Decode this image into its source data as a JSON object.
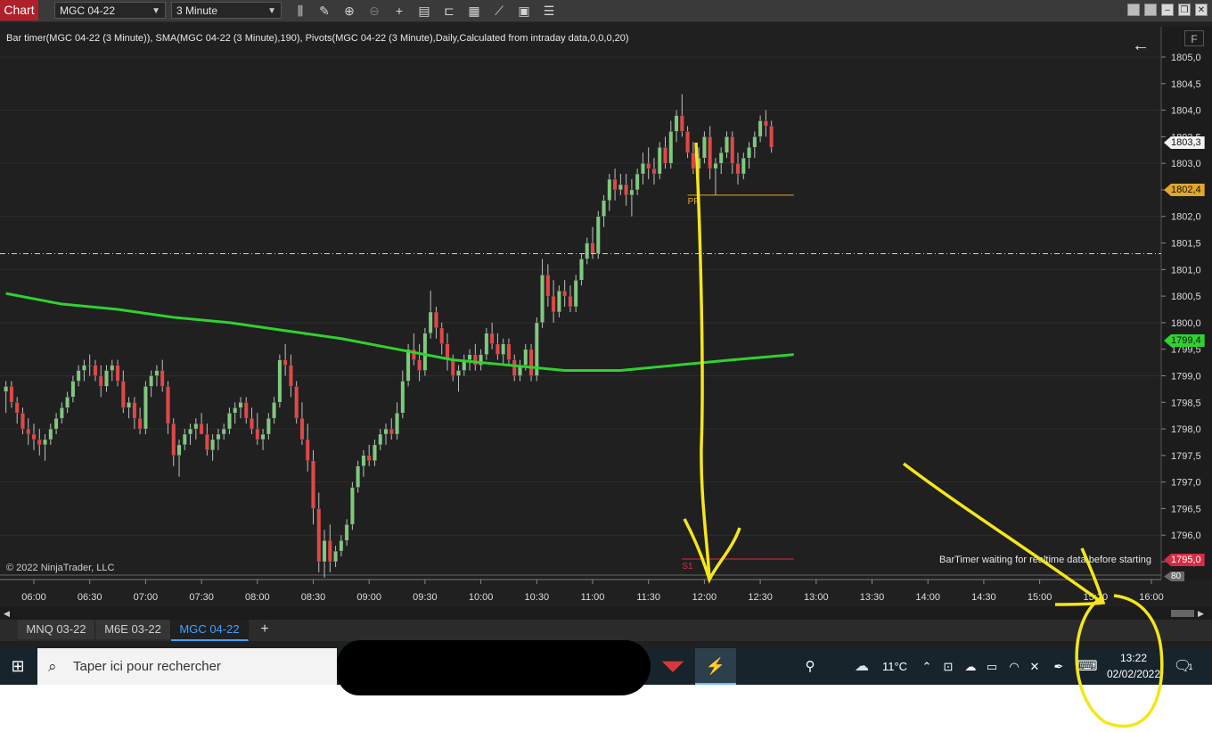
{
  "toolbar": {
    "app_tab": "Chart",
    "instrument": "MGC 04-22",
    "interval": "3 Minute",
    "icons": [
      "bar-type-icon",
      "pencil-icon",
      "zoom-in-icon",
      "zoom-out-icon",
      "crosshair-icon",
      "data-box-icon",
      "properties-icon",
      "strategy-icon",
      "indicator-icon",
      "templates-icon",
      "list-icon"
    ],
    "window_buttons": [
      "restore-icon",
      "restore-icon",
      "minimize-icon",
      "maximize-icon",
      "close-icon"
    ]
  },
  "chart": {
    "indicator_label": "Bar timer(MGC 04-22 (3 Minute)), SMA(MGC 04-22 (3 Minute),190), Pivots(MGC 04-22 (3 Minute),Daily,Calculated from intraday data,0,0,0,20)",
    "copyright": "© 2022 NinjaTrader, LLC",
    "bartimer_message": "BarTimer waiting for realtime data before starting",
    "f_button": "F",
    "pivot_pp_label": "PP",
    "pivot_s1_label": "S1",
    "price_tags": {
      "last": "1803,3",
      "pp": "1802,4",
      "sma": "1799,4",
      "s1": "1795,0",
      "volume": "80"
    }
  },
  "chart_data": {
    "type": "candlestick",
    "instrument": "MGC 04-22",
    "interval": "3 Minute",
    "y_axis_labels": [
      "1805,0",
      "1804,5",
      "1804,0",
      "1803,5",
      "1803,0",
      "1802,5",
      "1802,0",
      "1801,5",
      "1801,0",
      "1800,5",
      "1800,0",
      "1799,5",
      "1799,0",
      "1798,5",
      "1798,0",
      "1797,5",
      "1797,0",
      "1796,5",
      "1796,0",
      "1795,5"
    ],
    "x_axis_labels": [
      "06:00",
      "06:30",
      "07:00",
      "07:30",
      "08:00",
      "08:30",
      "09:00",
      "09:30",
      "10:00",
      "10:30",
      "11:00",
      "11:30",
      "12:00",
      "12:30",
      "13:00",
      "13:30",
      "14:00",
      "14:30",
      "15:00",
      "15:30",
      "16:00"
    ],
    "ylim": [
      1795.2,
      1805.3
    ],
    "start_time": "05:45",
    "bar_minutes": 3,
    "ohlc": [
      [
        1798.7,
        1798.9,
        1798.3,
        1798.8
      ],
      [
        1798.8,
        1798.9,
        1798.4,
        1798.5
      ],
      [
        1798.5,
        1798.6,
        1798.1,
        1798.3
      ],
      [
        1798.3,
        1798.4,
        1797.9,
        1798.0
      ],
      [
        1798.0,
        1798.2,
        1797.7,
        1797.9
      ],
      [
        1797.9,
        1798.1,
        1797.6,
        1797.8
      ],
      [
        1797.8,
        1798.0,
        1797.5,
        1797.7
      ],
      [
        1797.7,
        1797.9,
        1797.4,
        1797.8
      ],
      [
        1797.8,
        1798.1,
        1797.7,
        1798.0
      ],
      [
        1798.0,
        1798.3,
        1797.9,
        1798.2
      ],
      [
        1798.2,
        1798.5,
        1798.1,
        1798.4
      ],
      [
        1798.4,
        1798.7,
        1798.3,
        1798.6
      ],
      [
        1798.6,
        1799.0,
        1798.5,
        1798.9
      ],
      [
        1798.9,
        1799.2,
        1798.8,
        1799.1
      ],
      [
        1799.1,
        1799.3,
        1798.9,
        1799.2
      ],
      [
        1799.2,
        1799.4,
        1799.0,
        1799.2
      ],
      [
        1799.2,
        1799.3,
        1798.9,
        1799.0
      ],
      [
        1799.0,
        1799.2,
        1798.6,
        1798.8
      ],
      [
        1798.8,
        1799.2,
        1798.7,
        1799.1
      ],
      [
        1799.1,
        1799.3,
        1798.9,
        1799.2
      ],
      [
        1799.2,
        1799.3,
        1798.8,
        1798.9
      ],
      [
        1798.9,
        1799.1,
        1798.3,
        1798.4
      ],
      [
        1798.4,
        1798.6,
        1798.2,
        1798.5
      ],
      [
        1798.5,
        1798.6,
        1798.0,
        1798.2
      ],
      [
        1798.2,
        1798.4,
        1797.9,
        1798.0
      ],
      [
        1798.0,
        1798.9,
        1797.9,
        1798.8
      ],
      [
        1798.8,
        1799.1,
        1798.6,
        1799.0
      ],
      [
        1799.0,
        1799.2,
        1798.8,
        1799.1
      ],
      [
        1799.1,
        1799.3,
        1798.7,
        1798.8
      ],
      [
        1798.8,
        1798.9,
        1797.9,
        1798.1
      ],
      [
        1798.1,
        1798.2,
        1797.3,
        1797.5
      ],
      [
        1797.5,
        1797.8,
        1797.1,
        1797.7
      ],
      [
        1797.7,
        1798.0,
        1797.6,
        1797.9
      ],
      [
        1797.9,
        1798.1,
        1797.7,
        1798.0
      ],
      [
        1798.0,
        1798.2,
        1797.8,
        1798.1
      ],
      [
        1798.1,
        1798.3,
        1797.9,
        1797.9
      ],
      [
        1797.9,
        1798.1,
        1797.5,
        1797.6
      ],
      [
        1797.6,
        1797.9,
        1797.4,
        1797.8
      ],
      [
        1797.8,
        1798.0,
        1797.6,
        1797.9
      ],
      [
        1797.9,
        1798.1,
        1797.8,
        1798.0
      ],
      [
        1798.0,
        1798.4,
        1797.9,
        1798.3
      ],
      [
        1798.3,
        1798.5,
        1798.1,
        1798.4
      ],
      [
        1798.4,
        1798.6,
        1798.2,
        1798.5
      ],
      [
        1798.5,
        1798.6,
        1798.1,
        1798.2
      ],
      [
        1798.2,
        1798.4,
        1797.9,
        1798.0
      ],
      [
        1798.0,
        1798.3,
        1797.7,
        1797.8
      ],
      [
        1797.8,
        1798.0,
        1797.6,
        1797.9
      ],
      [
        1797.9,
        1798.3,
        1797.8,
        1798.2
      ],
      [
        1798.2,
        1798.6,
        1798.1,
        1798.5
      ],
      [
        1798.5,
        1799.4,
        1798.4,
        1799.3
      ],
      [
        1799.3,
        1799.6,
        1799.0,
        1799.2
      ],
      [
        1799.2,
        1799.4,
        1798.6,
        1798.8
      ],
      [
        1798.8,
        1798.9,
        1798.1,
        1798.2
      ],
      [
        1798.2,
        1798.5,
        1797.7,
        1797.8
      ],
      [
        1797.8,
        1798.1,
        1797.2,
        1797.4
      ],
      [
        1797.4,
        1797.6,
        1796.2,
        1796.5
      ],
      [
        1796.5,
        1796.8,
        1795.3,
        1795.5
      ],
      [
        1795.5,
        1796.1,
        1795.2,
        1795.9
      ],
      [
        1795.9,
        1796.2,
        1795.3,
        1795.5
      ],
      [
        1795.5,
        1795.8,
        1795.4,
        1795.7
      ],
      [
        1795.7,
        1796.0,
        1795.6,
        1795.9
      ],
      [
        1795.9,
        1796.3,
        1795.8,
        1796.2
      ],
      [
        1796.2,
        1797.0,
        1796.1,
        1796.9
      ],
      [
        1796.9,
        1797.4,
        1796.8,
        1797.3
      ],
      [
        1797.3,
        1797.6,
        1797.1,
        1797.5
      ],
      [
        1797.5,
        1797.7,
        1797.3,
        1797.4
      ],
      [
        1797.4,
        1797.8,
        1797.3,
        1797.7
      ],
      [
        1797.7,
        1798.0,
        1797.6,
        1797.9
      ],
      [
        1797.9,
        1798.1,
        1797.7,
        1798.0
      ],
      [
        1798.0,
        1798.2,
        1797.8,
        1797.9
      ],
      [
        1797.9,
        1798.5,
        1797.8,
        1798.3
      ],
      [
        1798.3,
        1799.1,
        1798.2,
        1798.9
      ],
      [
        1798.9,
        1799.6,
        1798.8,
        1799.5
      ],
      [
        1799.5,
        1799.8,
        1799.2,
        1799.3
      ],
      [
        1799.3,
        1799.6,
        1798.9,
        1799.1
      ],
      [
        1799.1,
        1799.9,
        1799.0,
        1799.8
      ],
      [
        1799.8,
        1800.6,
        1799.7,
        1800.2
      ],
      [
        1800.2,
        1800.3,
        1799.7,
        1799.9
      ],
      [
        1799.9,
        1800.0,
        1799.4,
        1799.6
      ],
      [
        1799.6,
        1799.8,
        1799.1,
        1799.3
      ],
      [
        1799.3,
        1799.4,
        1798.9,
        1799.0
      ],
      [
        1799.0,
        1799.2,
        1798.7,
        1799.1
      ],
      [
        1799.1,
        1799.4,
        1799.0,
        1799.3
      ],
      [
        1799.3,
        1799.5,
        1799.1,
        1799.4
      ],
      [
        1799.4,
        1799.6,
        1799.1,
        1799.2
      ],
      [
        1799.2,
        1799.5,
        1799.1,
        1799.4
      ],
      [
        1799.4,
        1799.9,
        1799.3,
        1799.8
      ],
      [
        1799.8,
        1800.0,
        1799.5,
        1799.6
      ],
      [
        1799.6,
        1799.8,
        1799.3,
        1799.4
      ],
      [
        1799.4,
        1799.7,
        1799.2,
        1799.6
      ],
      [
        1799.6,
        1799.7,
        1799.2,
        1799.3
      ],
      [
        1799.3,
        1799.4,
        1798.9,
        1799.0
      ],
      [
        1799.0,
        1799.3,
        1798.9,
        1799.2
      ],
      [
        1799.2,
        1799.6,
        1799.1,
        1799.5
      ],
      [
        1799.5,
        1799.6,
        1798.9,
        1799.0
      ],
      [
        1799.0,
        1800.1,
        1798.9,
        1800.0
      ],
      [
        1800.0,
        1801.2,
        1799.9,
        1800.9
      ],
      [
        1800.9,
        1801.1,
        1800.3,
        1800.5
      ],
      [
        1800.5,
        1800.8,
        1800.0,
        1800.2
      ],
      [
        1800.2,
        1800.7,
        1800.1,
        1800.6
      ],
      [
        1800.6,
        1800.8,
        1800.3,
        1800.5
      ],
      [
        1800.5,
        1800.7,
        1800.2,
        1800.3
      ],
      [
        1800.3,
        1800.9,
        1800.2,
        1800.8
      ],
      [
        1800.8,
        1801.3,
        1800.7,
        1801.2
      ],
      [
        1801.2,
        1801.6,
        1801.1,
        1801.5
      ],
      [
        1801.5,
        1801.8,
        1801.2,
        1801.3
      ],
      [
        1801.3,
        1802.1,
        1801.2,
        1802.0
      ],
      [
        1802.0,
        1802.4,
        1801.8,
        1802.3
      ],
      [
        1802.3,
        1802.8,
        1802.1,
        1802.7
      ],
      [
        1802.7,
        1802.9,
        1802.3,
        1802.5
      ],
      [
        1802.5,
        1802.8,
        1802.4,
        1802.6
      ],
      [
        1802.6,
        1802.8,
        1802.2,
        1802.4
      ],
      [
        1802.4,
        1802.7,
        1802.0,
        1802.5
      ],
      [
        1802.5,
        1802.9,
        1802.4,
        1802.8
      ],
      [
        1802.8,
        1803.2,
        1802.6,
        1803.0
      ],
      [
        1803.0,
        1803.3,
        1802.7,
        1802.9
      ],
      [
        1802.9,
        1803.1,
        1802.6,
        1802.8
      ],
      [
        1802.8,
        1803.4,
        1802.7,
        1803.3
      ],
      [
        1803.3,
        1803.5,
        1802.9,
        1803.0
      ],
      [
        1803.0,
        1803.8,
        1802.9,
        1803.6
      ],
      [
        1803.6,
        1804.0,
        1803.4,
        1803.9
      ],
      [
        1803.9,
        1804.3,
        1803.5,
        1803.6
      ],
      [
        1803.6,
        1803.7,
        1803.1,
        1803.2
      ],
      [
        1803.2,
        1803.4,
        1802.8,
        1802.9
      ],
      [
        1802.9,
        1803.3,
        1802.7,
        1803.1
      ],
      [
        1803.1,
        1803.6,
        1803.0,
        1803.5
      ],
      [
        1803.5,
        1803.7,
        1802.7,
        1802.9
      ],
      [
        1802.9,
        1803.1,
        1802.4,
        1803.0
      ],
      [
        1803.0,
        1803.3,
        1802.8,
        1803.2
      ],
      [
        1803.2,
        1803.6,
        1803.1,
        1803.5
      ],
      [
        1803.5,
        1803.6,
        1802.8,
        1803.0
      ],
      [
        1803.0,
        1803.2,
        1802.6,
        1802.8
      ],
      [
        1802.8,
        1803.2,
        1802.7,
        1803.1
      ],
      [
        1803.1,
        1803.4,
        1802.9,
        1803.3
      ],
      [
        1803.3,
        1803.6,
        1803.1,
        1803.5
      ],
      [
        1803.5,
        1803.9,
        1803.4,
        1803.8
      ],
      [
        1803.8,
        1804.0,
        1803.5,
        1803.7
      ],
      [
        1803.7,
        1803.8,
        1803.2,
        1803.3
      ]
    ],
    "sma": [
      [
        0,
        1800.55
      ],
      [
        10,
        1800.35
      ],
      [
        20,
        1800.25
      ],
      [
        30,
        1800.1
      ],
      [
        40,
        1800.0
      ],
      [
        50,
        1799.85
      ],
      [
        60,
        1799.7
      ],
      [
        70,
        1799.5
      ],
      [
        80,
        1799.3
      ],
      [
        90,
        1799.2
      ],
      [
        100,
        1799.1
      ],
      [
        110,
        1799.1
      ],
      [
        120,
        1799.2
      ],
      [
        130,
        1799.3
      ],
      [
        141,
        1799.4
      ]
    ],
    "pivots": {
      "pp": 1802.4,
      "s1": 1795.0,
      "pp_from_bar": 122,
      "s1_from_bar": 121,
      "to_bar": 141
    },
    "last_price_line": 1801.3
  },
  "instrument_tabs": {
    "tabs": [
      "MNQ 03-22",
      "M6E 03-22",
      "MGC 04-22"
    ],
    "active": 2,
    "add_label": "+"
  },
  "taskbar": {
    "search_placeholder": "Taper ici pour rechercher",
    "temperature": "11°C",
    "time": "13:22",
    "date": "02/02/2022",
    "notification_count": "1"
  },
  "annotation": {
    "color": "#f4e61b"
  }
}
